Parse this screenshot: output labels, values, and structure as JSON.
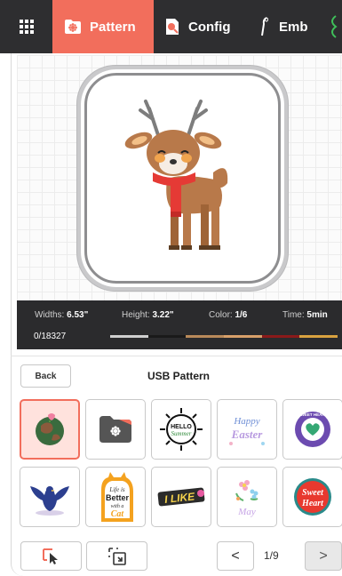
{
  "tabs": {
    "pattern": "Pattern",
    "config": "Config",
    "emb": "Emb"
  },
  "info": {
    "width_label": "Widths:",
    "width_value": "6.53\"",
    "height_label": "Height:",
    "height_value": "3.22\"",
    "color_label": "Color:",
    "color_value": "1/6",
    "time_label": "Time:",
    "time_value": "5min",
    "stitch_count": "0/18327"
  },
  "thread_colors": [
    "#cfcfcf",
    "#1a1a1a",
    "#b98a5a",
    "#d8a06a",
    "#8b1a1a",
    "#d9a23f"
  ],
  "section": {
    "back_label": "Back",
    "title": "USB Pattern"
  },
  "pagination": {
    "prev": "<",
    "indicator": "1/9",
    "next": ">"
  },
  "colors": {
    "accent": "#f26e5c",
    "topbar": "#2e2e30",
    "infobar": "#2b2b2d"
  },
  "patterns": [
    {
      "icon": "earth-globe-icon",
      "selected": true
    },
    {
      "icon": "folder-icon",
      "selected": false
    },
    {
      "icon": "hello-summer-sun-icon",
      "selected": false
    },
    {
      "icon": "happy-easter-text-icon",
      "selected": false
    },
    {
      "icon": "sweet-heart-badge-icon",
      "selected": false
    },
    {
      "icon": "blue-bird-icon",
      "selected": false
    },
    {
      "icon": "life-better-cat-icon",
      "selected": false
    },
    {
      "icon": "i-like-text-icon",
      "selected": false
    },
    {
      "icon": "flowers-may-icon",
      "selected": false
    },
    {
      "icon": "sweet-heart-circle-icon",
      "selected": false
    }
  ],
  "tile_text": {
    "hello": "HELLO",
    "summer": "Summer",
    "happy": "Happy",
    "easter": "Easter",
    "sweet_heart": "SWEET HEART",
    "life_is": "Life is",
    "better": "Better",
    "with_a": "with a",
    "cat": "Cat",
    "i_like": "I LIKE",
    "may": "May",
    "sweet": "Sweet",
    "heart": "Heart"
  }
}
